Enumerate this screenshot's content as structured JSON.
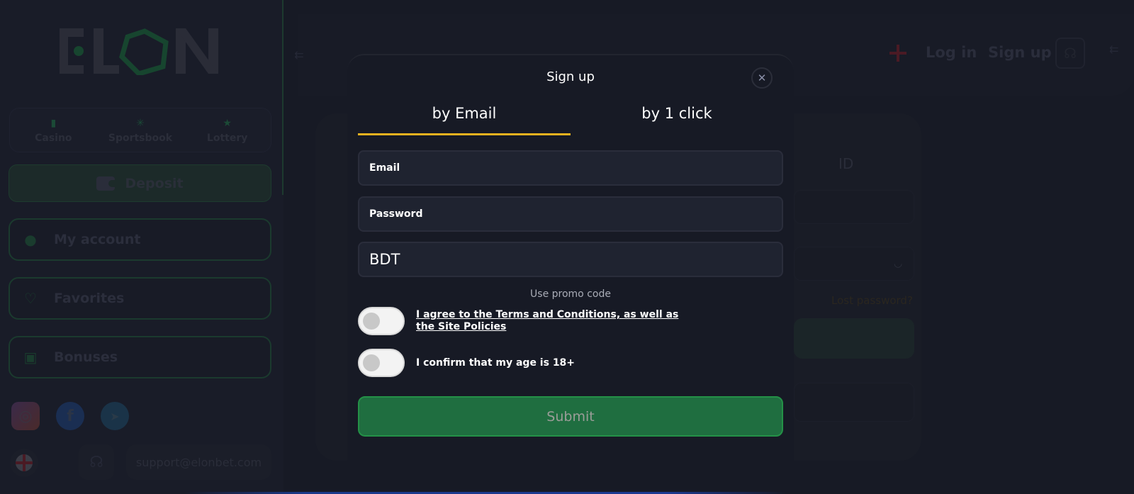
{
  "sidebar": {
    "logo_text": "ELON",
    "nav": [
      {
        "label": "Casino",
        "icon": "casino-card-icon"
      },
      {
        "label": "Sportsbook",
        "icon": "basketball-icon"
      },
      {
        "label": "Lottery",
        "icon": "lottery-ticket-icon"
      }
    ],
    "deposit_label": "Deposit",
    "items": [
      {
        "label": "My account",
        "icon": "user-icon"
      },
      {
        "label": "Favorites",
        "icon": "heart-icon"
      },
      {
        "label": "Bonuses",
        "icon": "gift-icon"
      }
    ],
    "socials": [
      "instagram",
      "facebook",
      "telegram"
    ],
    "support_email": "support@elonbet.com"
  },
  "header": {
    "login_label": "Log in",
    "signup_label": "Sign up"
  },
  "background_form": {
    "id_label": "ID",
    "lost_password": "Lost password?"
  },
  "modal": {
    "title": "Sign up",
    "close_glyph": "✕",
    "tabs": [
      {
        "label": "by Email",
        "active": true
      },
      {
        "label": "by 1 click",
        "active": false
      }
    ],
    "email_placeholder": "Email",
    "password_placeholder": "Password",
    "currency_value": "BDT",
    "promo_label": "Use promo code",
    "terms_label": "I agree to the Terms and Conditions, as well as the Site Policies",
    "terms_checked": false,
    "age_label": "I confirm that my age is 18+",
    "age_checked": false,
    "submit_label": "Submit"
  },
  "colors": {
    "background": "#171a25",
    "accent_green": "#1f6e40",
    "tab_underline": "#e8b21f",
    "field_bg": "#1f2330"
  }
}
